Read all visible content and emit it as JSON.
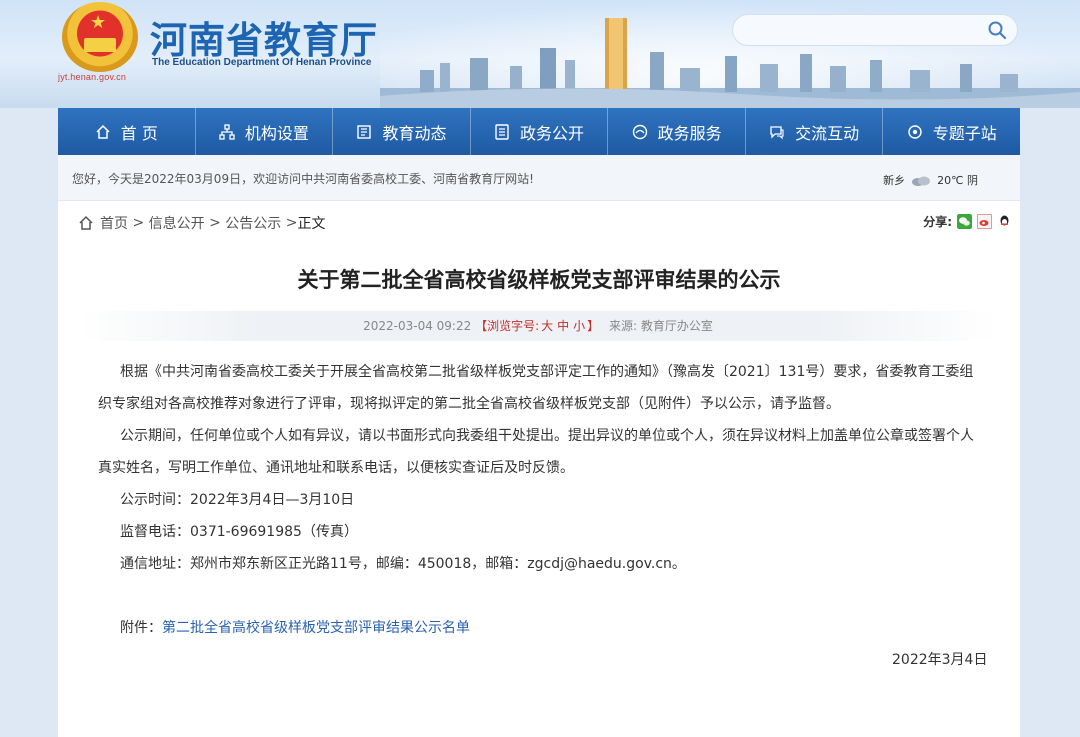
{
  "site": {
    "emblem_url": "jyt.henan.gov.cn",
    "title": "河南省教育厅",
    "subtitle": "The Education Department Of Henan Province"
  },
  "search": {
    "placeholder": ""
  },
  "nav": [
    {
      "label": "首 页",
      "icon": "home-icon"
    },
    {
      "label": "机构设置",
      "icon": "org-icon"
    },
    {
      "label": "教育动态",
      "icon": "news-icon"
    },
    {
      "label": "政务公开",
      "icon": "document-icon"
    },
    {
      "label": "政务服务",
      "icon": "service-icon"
    },
    {
      "label": "交流互动",
      "icon": "chat-icon"
    },
    {
      "label": "专题子站",
      "icon": "topic-icon"
    }
  ],
  "notice": {
    "text": "您好，今天是2022年03月09日，欢迎访问中共河南省委高校工委、河南省教育厅网站!",
    "weather_city": "新乡",
    "weather_temp": "20℃ 阴"
  },
  "breadcrumb": {
    "home": "首页",
    "sep1": " > ",
    "info": "信息公开",
    "sep2": " > ",
    "notice": "公告公示",
    "sep3": " >",
    "current": "正文"
  },
  "share": {
    "label": "分享:"
  },
  "article": {
    "title": "关于第二批全省高校省级样板党支部评审结果的公示",
    "date": "2022-03-04 09:22",
    "font_size_label": "【浏览字号:",
    "font_large": "大",
    "font_medium": "中",
    "font_small": "小",
    "font_size_end": "】",
    "source": "来源: 教育厅办公室",
    "p1_line1": "根据《中共河南省委高校工委关于开展全省高校第二批省级样板党支部评定工作的通知》（豫高发〔2021〕131号）要求，省委教育工委组",
    "p1_line2": "织专家组对各高校推荐对象进行了评审，现将拟评定的第二批全省高校省级样板党支部（见附件）予以公示，请予监督。",
    "p2_line1": "公示期间，任何单位或个人如有异议，请以书面形式向我委组干处提出。提出异议的单位或个人，须在异议材料上加盖单位公章或签署个人",
    "p2_line2": "真实姓名，写明工作单位、通讯地址和联系电话，以便核实查证后及时反馈。",
    "period": "公示时间：2022年3月4日—3月10日",
    "phone": "监督电话：0371-69691985（传真）",
    "address": "通信地址：郑州市郑东新区正光路11号，邮编：450018，邮箱：zgcdj@haedu.gov.cn。",
    "attachment_label": "附件：",
    "attachment_link": "第二批全省高校省级样板党支部评审结果公示名单",
    "sign_date": "2022年3月4日"
  },
  "colors": {
    "nav_blue": "#1f5aa3",
    "title_blue": "#1d64b3",
    "accent_red": "#c4302b",
    "link_blue": "#2a62b0"
  }
}
